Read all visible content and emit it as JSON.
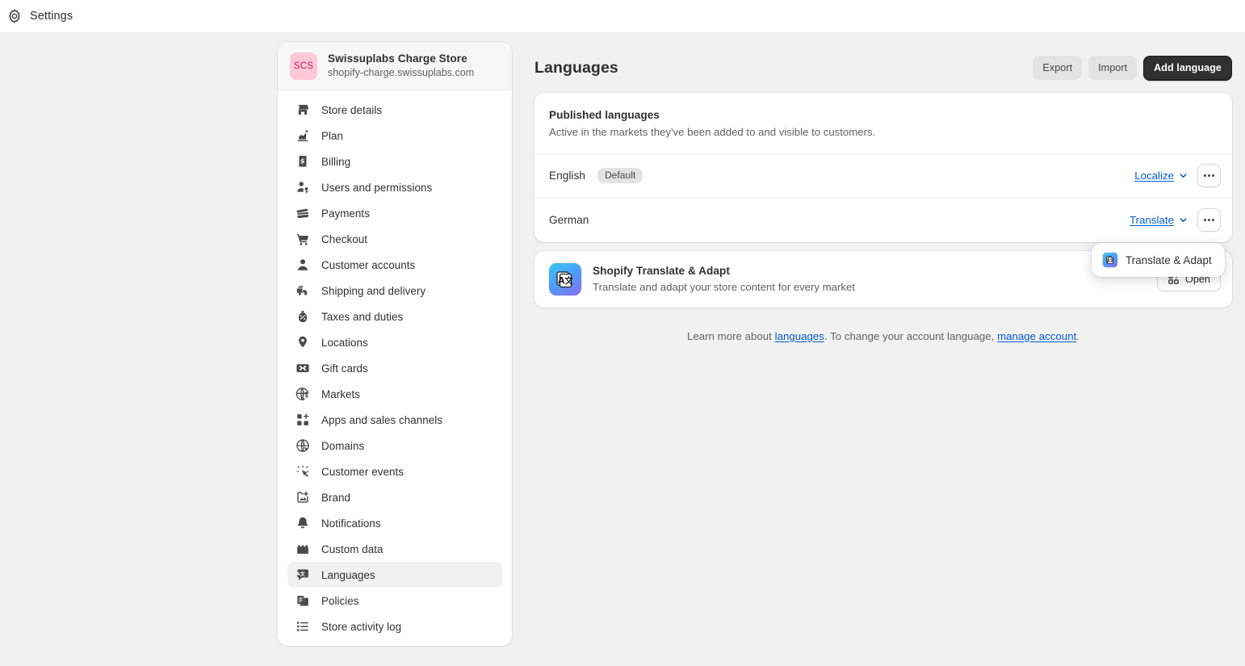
{
  "topbar": {
    "icon": "gear-icon",
    "title": "Settings"
  },
  "sidebar": {
    "store": {
      "initials": "SCS",
      "name": "Swissuplabs Charge Store",
      "domain": "shopify-charge.swissuplabs.com"
    },
    "items": [
      {
        "label": "Store details",
        "icon": "store-icon",
        "active": false
      },
      {
        "label": "Plan",
        "icon": "plan-icon",
        "active": false
      },
      {
        "label": "Billing",
        "icon": "billing-icon",
        "active": false
      },
      {
        "label": "Users and permissions",
        "icon": "users-icon",
        "active": false
      },
      {
        "label": "Payments",
        "icon": "payments-icon",
        "active": false
      },
      {
        "label": "Checkout",
        "icon": "checkout-cart-icon",
        "active": false
      },
      {
        "label": "Customer accounts",
        "icon": "customer-accounts-icon",
        "active": false
      },
      {
        "label": "Shipping and delivery",
        "icon": "shipping-truck-icon",
        "active": false
      },
      {
        "label": "Taxes and duties",
        "icon": "taxes-icon",
        "active": false
      },
      {
        "label": "Locations",
        "icon": "location-pin-icon",
        "active": false
      },
      {
        "label": "Gift cards",
        "icon": "gift-card-icon",
        "active": false
      },
      {
        "label": "Markets",
        "icon": "markets-globe-icon",
        "active": false
      },
      {
        "label": "Apps and sales channels",
        "icon": "apps-icon",
        "active": false
      },
      {
        "label": "Domains",
        "icon": "domains-globe-icon",
        "active": false
      },
      {
        "label": "Customer events",
        "icon": "customer-events-icon",
        "active": false
      },
      {
        "label": "Brand",
        "icon": "brand-image-icon",
        "active": false
      },
      {
        "label": "Notifications",
        "icon": "bell-icon",
        "active": false
      },
      {
        "label": "Custom data",
        "icon": "custom-data-icon",
        "active": false
      },
      {
        "label": "Languages",
        "icon": "languages-icon",
        "active": true
      },
      {
        "label": "Policies",
        "icon": "policies-icon",
        "active": false
      },
      {
        "label": "Store activity log",
        "icon": "activity-log-icon",
        "active": false
      }
    ]
  },
  "main": {
    "title": "Languages",
    "actions": {
      "export": "Export",
      "import": "Import",
      "add_language": "Add language"
    },
    "published_card": {
      "title": "Published languages",
      "subtitle": "Active in the markets they've been added to and visible to customers.",
      "rows": [
        {
          "language": "English",
          "badge": "Default",
          "action_label": "Localize",
          "action_icon": "chevron-down-icon",
          "more_icon": "more-horizontal-icon"
        },
        {
          "language": "German",
          "badge": "",
          "action_label": "Translate",
          "action_icon": "chevron-down-icon",
          "more_icon": "more-horizontal-icon"
        }
      ]
    },
    "app_card": {
      "icon": "translate-adapt-app-icon",
      "title": "Shopify Translate & Adapt",
      "subtitle": "Translate and adapt your store content for every market",
      "open_label": "Open",
      "open_icon": "apps-grid-icon"
    },
    "footnote": {
      "prefix": "Learn more about ",
      "link1": "languages",
      "middle": ". To change your account language, ",
      "link2": "manage account",
      "suffix": "."
    }
  },
  "popover": {
    "items": [
      {
        "label": "Translate & Adapt",
        "icon": "translate-adapt-app-icon"
      }
    ]
  },
  "colors": {
    "page_bg": "#f1f1f1",
    "card_bg": "#ffffff",
    "link": "#005bd3",
    "primary_button": "#303030",
    "text": "#303030",
    "muted_text": "#616161",
    "avatar_bg": "#ffc8d6",
    "avatar_text": "#b4215f",
    "badge_bg": "#e3e3e3",
    "active_nav_bg": "#f1f1f1"
  }
}
